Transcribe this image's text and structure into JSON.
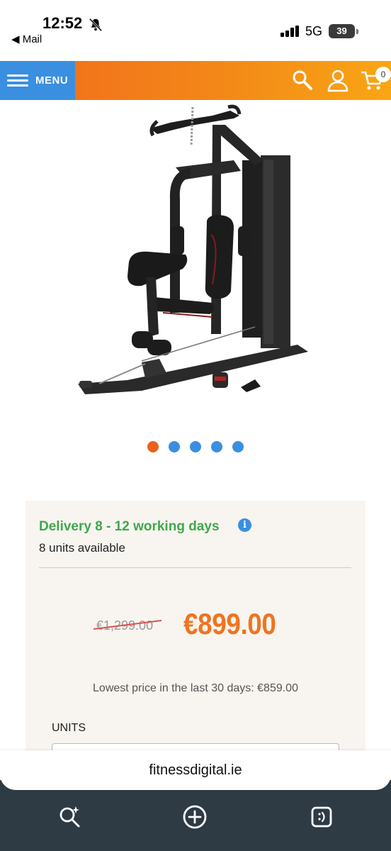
{
  "status_bar": {
    "time": "12:52",
    "back_app": "◀ Mail",
    "network": "5G",
    "battery": "39"
  },
  "header": {
    "menu_label": "MENU",
    "cart_count": "0"
  },
  "carousel": {
    "total_slides": 5,
    "active_index": 0
  },
  "product": {
    "delivery": "Delivery 8 - 12 working days",
    "units_available": "8 units available",
    "old_price": "€1,299.00",
    "price": "€899.00",
    "lowest_price_note": "Lowest price in the last 30 days: €859.00",
    "units_label": "UNITS"
  },
  "browser": {
    "url": "fitnessdigital.ie"
  },
  "colors": {
    "header_orange": "#f38a18",
    "menu_blue": "#3a8fe0",
    "delivery_green": "#3fa84a",
    "price_orange": "#ef7420",
    "active_dot": "#e8631c"
  },
  "icons": {
    "search": "search-icon",
    "account": "user-icon",
    "cart": "cart-icon",
    "info": "info-icon",
    "visual_search": "visual-search-icon",
    "new_tab": "plus-circle-icon",
    "tabs": "tabs-icon"
  }
}
